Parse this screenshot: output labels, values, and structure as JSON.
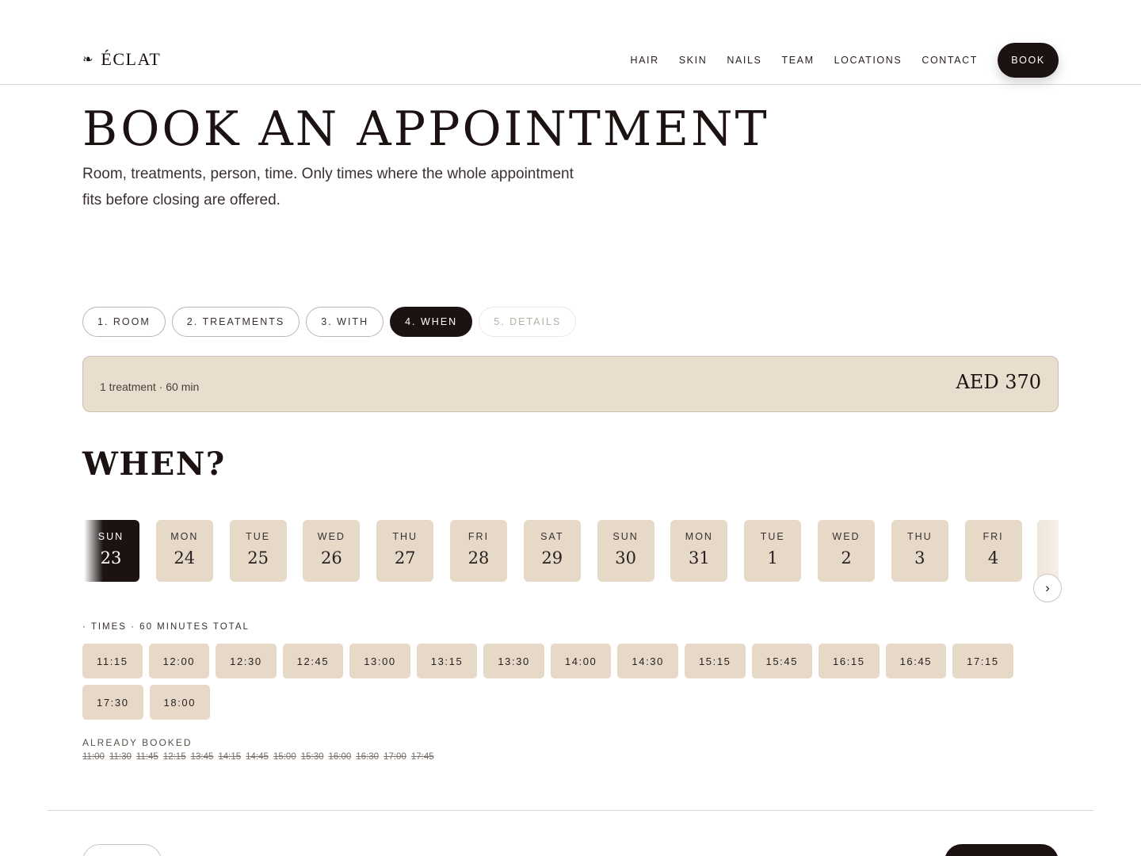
{
  "header": {
    "logo_mark": "❧",
    "logo_text": "ÉCLAT",
    "nav": [
      "HAIR",
      "SKIN",
      "NAILS",
      "TEAM",
      "LOCATIONS",
      "CONTACT"
    ],
    "book_label": "BOOK"
  },
  "page": {
    "title": "BOOK AN APPOINTMENT",
    "subtitle": "Room, treatments, person, time. Only times where the whole appointment fits before closing are offered."
  },
  "steps": [
    {
      "label": "1. ROOM",
      "state": "done"
    },
    {
      "label": "2. TREATMENTS",
      "state": "done"
    },
    {
      "label": "3. WITH",
      "state": "done"
    },
    {
      "label": "4. WHEN",
      "state": "active"
    },
    {
      "label": "5. DETAILS",
      "state": "disabled"
    }
  ],
  "summary": {
    "left": "1 treatment · 60 min",
    "price": "AED 370"
  },
  "when": {
    "title": "WHEN?",
    "days": [
      {
        "dow": "SUN",
        "num": "23",
        "selected": true
      },
      {
        "dow": "MON",
        "num": "24"
      },
      {
        "dow": "TUE",
        "num": "25"
      },
      {
        "dow": "WED",
        "num": "26"
      },
      {
        "dow": "THU",
        "num": "27"
      },
      {
        "dow": "FRI",
        "num": "28"
      },
      {
        "dow": "SAT",
        "num": "29"
      },
      {
        "dow": "SUN",
        "num": "30"
      },
      {
        "dow": "MON",
        "num": "31"
      },
      {
        "dow": "TUE",
        "num": "1"
      },
      {
        "dow": "WED",
        "num": "2"
      },
      {
        "dow": "THU",
        "num": "3"
      },
      {
        "dow": "FRI",
        "num": "4"
      }
    ],
    "next_label": "›",
    "times_label": "· TIMES · 60 MINUTES TOTAL",
    "times": [
      "11:15",
      "12:00",
      "12:30",
      "12:45",
      "13:00",
      "13:15",
      "13:30",
      "14:00",
      "14:30",
      "15:15",
      "15:45",
      "16:15",
      "16:45",
      "17:15",
      "17:30",
      "18:00"
    ],
    "booked_label": "ALREADY BOOKED",
    "booked": [
      "11:00",
      "11:30",
      "11:45",
      "12:15",
      "13:45",
      "14:15",
      "14:45",
      "15:00",
      "15:30",
      "16:00",
      "16:30",
      "17:00",
      "17:45"
    ]
  }
}
